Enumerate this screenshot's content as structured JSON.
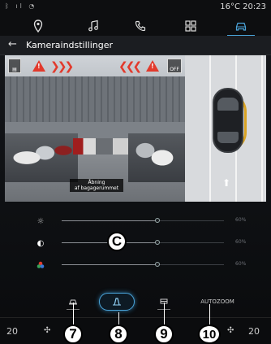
{
  "status_bar": {
    "left_icons": [
      "bluetooth-icon",
      "signal-icon",
      "wifi-icon"
    ],
    "temperature": "16°C",
    "time": "20:23"
  },
  "nav": {
    "items": [
      "navigation-icon",
      "music-icon",
      "phone-icon",
      "apps-icon",
      "car-icon"
    ],
    "active_index": 4,
    "accent_color": "#4aa3d8"
  },
  "header": {
    "title": "Kameraindstillinger"
  },
  "camera_view": {
    "caption_line1": "Åbning",
    "caption_line2": "af bagagerummet",
    "off_label": "OFF",
    "warning_color": "#e23a2c"
  },
  "sliders": [
    {
      "name": "brightness",
      "icon": "brightness-icon",
      "value_label": "60%",
      "value": 0.6
    },
    {
      "name": "contrast",
      "icon": "contrast-icon",
      "value_label": "60%",
      "value": 0.6
    },
    {
      "name": "color",
      "icon": "color-icon",
      "value_label": "60%",
      "value": 0.6
    }
  ],
  "modes": {
    "autozoom_label": "AUTOZOOM",
    "active_index": 1
  },
  "bottom": {
    "left_temp": "20",
    "right_temp": "20"
  },
  "callouts": {
    "c": "C",
    "n7": "7",
    "n8": "8",
    "n9": "9",
    "n10": "10"
  }
}
